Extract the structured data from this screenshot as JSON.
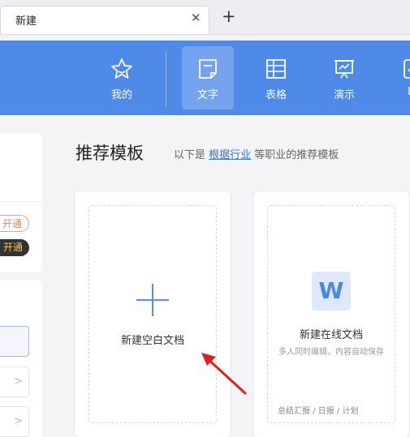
{
  "tabs": [
    {
      "title": "新建",
      "close": "✕"
    }
  ],
  "new_tab_symbol": "+",
  "header": {
    "bg_color": "#4f8ae8",
    "nav": [
      {
        "label": "我的",
        "icon": "star-icon",
        "active": false
      },
      {
        "label": "文字",
        "icon": "document-icon",
        "active": true
      },
      {
        "label": "表格",
        "icon": "table-icon",
        "active": false
      },
      {
        "label": "演示",
        "icon": "presentation-icon",
        "active": false
      },
      {
        "label": "PI",
        "icon": "pdf-icon",
        "active": false
      }
    ]
  },
  "sidebar": {
    "pills": [
      "开通",
      "开通"
    ]
  },
  "main": {
    "title": "推荐模板",
    "subtitle_prefix": "以下是 ",
    "subtitle_link": "根据行业",
    "subtitle_suffix": " 等职业的推荐模板",
    "cards": [
      {
        "label": "新建空白文档",
        "icon": "plus-icon"
      },
      {
        "label": "新建在线文档",
        "icon": "w-icon",
        "icon_text": "W",
        "sub": "多人同时编辑，内容自动保存",
        "footer": "总结汇报 / 日报 / 计划"
      }
    ]
  }
}
